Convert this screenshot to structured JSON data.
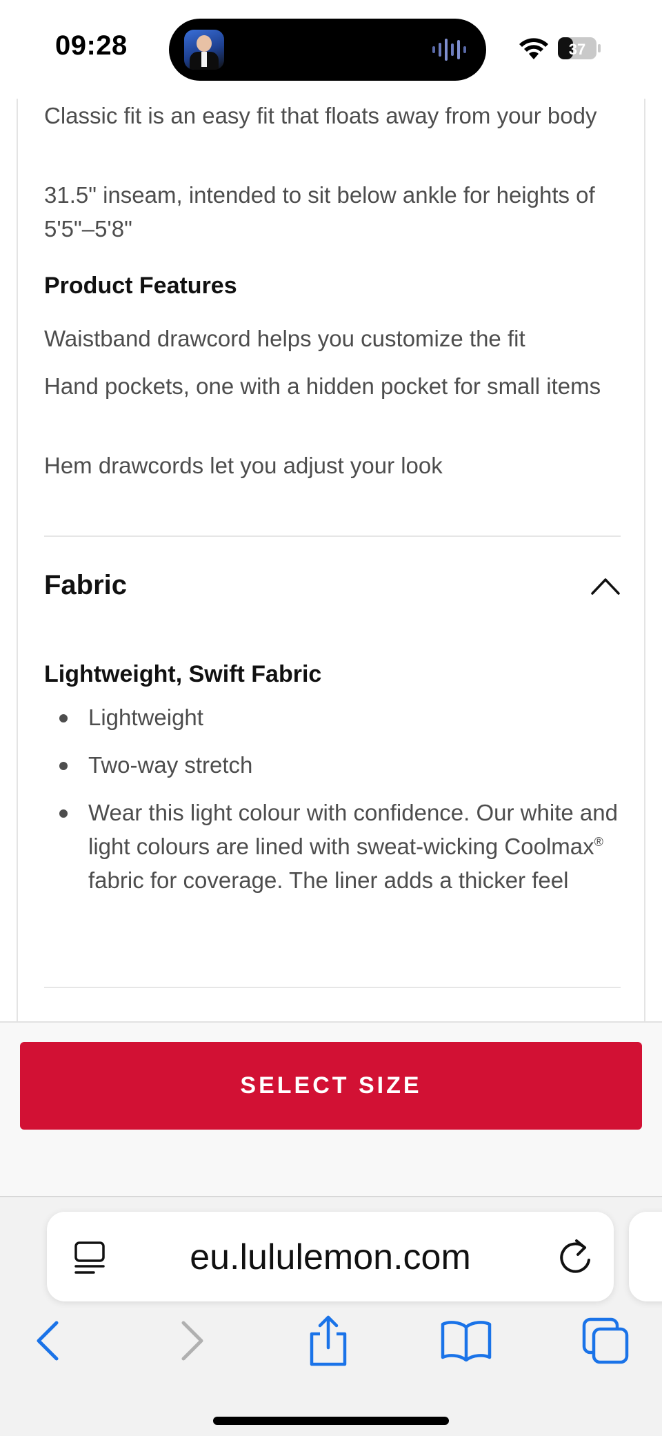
{
  "status_bar": {
    "time": "09:28",
    "battery_level": "37"
  },
  "details": {
    "fit_lines": [
      "Classic fit is an easy fit that floats away from your body",
      "31.5\" inseam, intended to sit below ankle for heights of 5'5\"–5'8\""
    ],
    "features_heading": "Product Features",
    "features": [
      "Waistband drawcord helps you customize the fit",
      "Hand pockets, one with a hidden pocket for small items",
      "Hem drawcords let you adjust your look"
    ]
  },
  "fabric": {
    "section_title": "Fabric",
    "expanded": true,
    "subheading": "Lightweight, Swift Fabric",
    "bullets": [
      "Lightweight",
      "Two-way stretch",
      "Wear this light colour with confidence. Our white and light colours are lined with sweat-wicking Coolmax"
    ],
    "registered_mark": "®",
    "bullet3_tail": " fabric for coverage. The liner adds a thicker feel"
  },
  "cta": {
    "select_size_label": "SELECT SIZE",
    "color": "#d21134"
  },
  "browser": {
    "url": "eu.lululemon.com",
    "icons": [
      "reader-icon",
      "reload-icon",
      "back-icon",
      "forward-icon",
      "share-icon",
      "bookmarks-icon",
      "tabs-icon"
    ],
    "accent": "#1a73e8"
  }
}
